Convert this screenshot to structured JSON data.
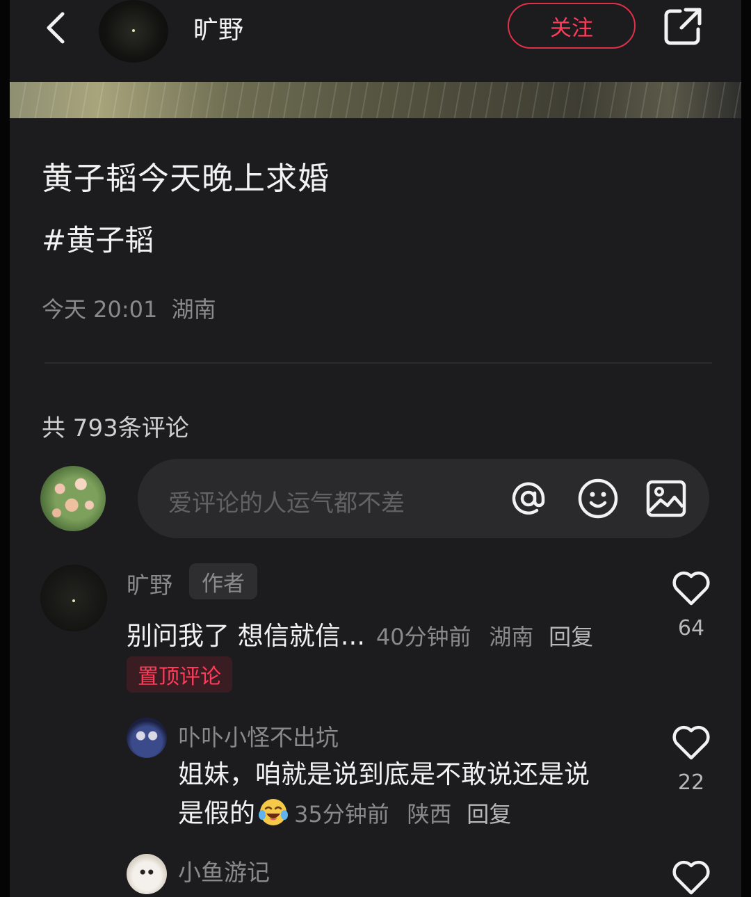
{
  "header": {
    "author_name": "旷野",
    "follow_label": "关注"
  },
  "post": {
    "title": "黄子韬今天晚上求婚",
    "tag": "#黄子韬",
    "time": "今天 20:01",
    "location": "湖南"
  },
  "comments_section": {
    "count_label": "共 793条评论",
    "input_placeholder": "爱评论的人运气都不差"
  },
  "comments": [
    {
      "name": "旷野",
      "badge": "作者",
      "text": "别问我了 想信就信...",
      "time": "40分钟前",
      "location": "湖南",
      "reply_label": "回复",
      "pinned_label": "置顶评论",
      "likes": "64"
    },
    {
      "name": "卟卟小怪不出坑",
      "text_line1": "姐妹，咱就是说到底是不敢说还是说",
      "text_line2": "是假的",
      "emoji": "laughing-crying-emoji",
      "time": "35分钟前",
      "location": "陕西",
      "reply_label": "回复",
      "likes": "22"
    },
    {
      "name": "小鱼游记"
    }
  ],
  "colors": {
    "accent": "#ff3b5a",
    "background": "#1c1c1e",
    "muted_text": "#8a8a8c"
  }
}
